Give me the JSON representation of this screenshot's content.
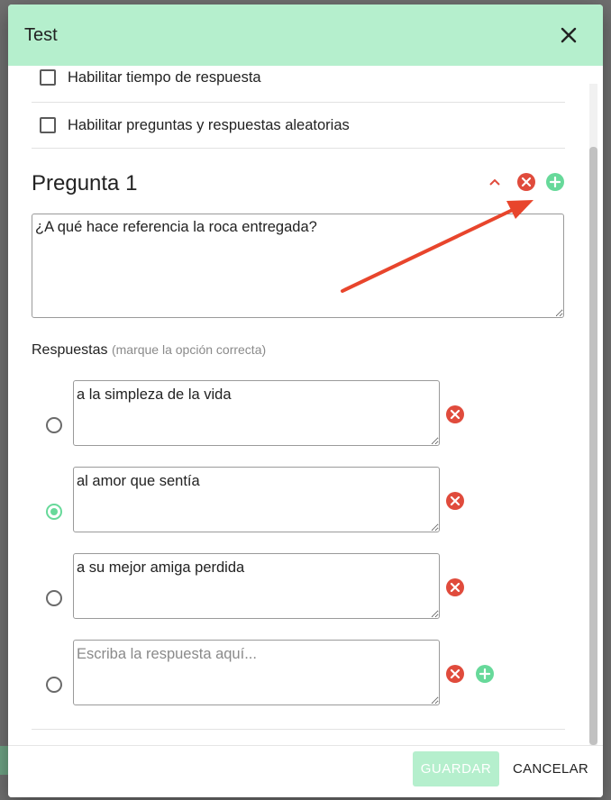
{
  "modal": {
    "title": "Test",
    "settings": [
      {
        "label": "Habilitar tiempo de respuesta",
        "checked": false
      },
      {
        "label": "Habilitar preguntas y respuestas aleatorias",
        "checked": false
      }
    ],
    "question": {
      "title": "Pregunta 1",
      "text": "¿A qué hace referencia la roca entregada?",
      "answers_label": "Respuestas",
      "answers_hint": "(marque la opción correcta)",
      "answers": [
        {
          "text": "a la simpleza de la vida",
          "selected": false
        },
        {
          "text": "al amor que sentía",
          "selected": true
        },
        {
          "text": "a su mejor amiga perdida",
          "selected": false
        },
        {
          "text": "",
          "placeholder": "Escriba la respuesta aquí...",
          "selected": false
        }
      ]
    },
    "footer": {
      "save_label": "GUARDAR",
      "cancel_label": "CANCELAR"
    }
  },
  "colors": {
    "header_bg": "#b5efcd",
    "accent_green": "#67d99a",
    "delete_red": "#e04b3c",
    "annotation_arrow": "#e8452c"
  },
  "icons": {
    "close": "close-icon",
    "collapse": "chevron-up-icon",
    "delete": "delete-circle-icon",
    "add": "add-circle-icon"
  }
}
